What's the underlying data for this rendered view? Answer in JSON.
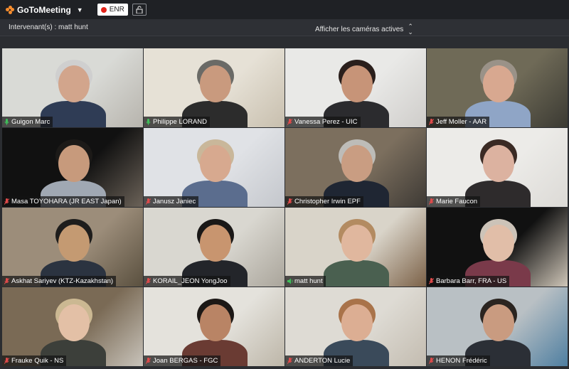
{
  "app": {
    "brand": "GoToMeeting",
    "record_label": "ENR",
    "speaker_label": "Intervenant(s) : matt hunt",
    "camera_filter": "Afficher les caméras actives"
  },
  "tiles": [
    {
      "name": "Guigon Marc",
      "mic": "on",
      "bg": "#d9dad6",
      "bg2": "#b7b4ad",
      "skin": "#d2a58c",
      "shirt": "#2f3c55",
      "hair": "#cfcfcf"
    },
    {
      "name": "Philippe LORAND",
      "mic": "on",
      "bg": "#e6e1d6",
      "bg2": "#c8bfae",
      "skin": "#c99a7e",
      "shirt": "#2c2c2c",
      "hair": "#6a6a66"
    },
    {
      "name": "Vanessa Perez - UIC",
      "mic": "muted",
      "bg": "#e9e9e7",
      "bg2": "#cfcdca",
      "skin": "#c79478",
      "shirt": "#2b2b2e",
      "hair": "#2a1f1c"
    },
    {
      "name": "Jeff Moller - AAR",
      "mic": "muted",
      "bg": "#6f6a57",
      "bg2": "#3b3a33",
      "skin": "#d8a890",
      "shirt": "#8fa5c6",
      "hair": "#9a9288"
    },
    {
      "name": "Masa TOYOHARA (JR EAST  Japan)",
      "mic": "muted",
      "bg": "#111111",
      "bg2": "#6b6258",
      "skin": "#c79a7c",
      "shirt": "#a0a8b3",
      "hair": "#1c1a18"
    },
    {
      "name": "Janusz Janiec",
      "mic": "muted",
      "bg": "#e0e2e6",
      "bg2": "#c4c7cc",
      "skin": "#d7a98f",
      "shirt": "#5b6d8e",
      "hair": "#c9b79a"
    },
    {
      "name": "Christopher Irwin  EPF",
      "mic": "muted",
      "bg": "#7c6f5e",
      "bg2": "#3e3a35",
      "skin": "#c99d82",
      "shirt": "#1f2633",
      "hair": "#bdbcb8"
    },
    {
      "name": "Marie Faucon",
      "mic": "muted",
      "bg": "#ecebe8",
      "bg2": "#dcdad6",
      "skin": "#dcb2a0",
      "shirt": "#2e2b2c",
      "hair": "#3a2a24"
    },
    {
      "name": "Askhat Sariyev (KTZ-Kazakhstan)",
      "mic": "muted",
      "bg": "#9c8d7a",
      "bg2": "#5a503f",
      "skin": "#c49a72",
      "shirt": "#2b3340",
      "hair": "#1e1d1c"
    },
    {
      "name": "KORAIL_JEON YongJoo",
      "mic": "muted",
      "bg": "#d9d7d0",
      "bg2": "#aaa59b",
      "skin": "#c8956f",
      "shirt": "#23252a",
      "hair": "#1a1817"
    },
    {
      "name": "matt hunt",
      "mic": "speaking",
      "bg": "#d9d4c9",
      "bg2": "#7c6248",
      "skin": "#e0b79e",
      "shirt": "#4a6050",
      "hair": "#b38b61"
    },
    {
      "name": "Barbara Barr, FRA - US",
      "mic": "muted",
      "bg": "#111111",
      "bg2": "#cfc6b8",
      "skin": "#e1bea8",
      "shirt": "#7a3a4a",
      "hair": "#ccc3b8"
    },
    {
      "name": "Frauke Quik - NS",
      "mic": "muted",
      "bg": "#7a6a55",
      "bg2": "#c8c3ba",
      "skin": "#e3c0a6",
      "shirt": "#3c3f3a",
      "hair": "#cbb892"
    },
    {
      "name": "Joan BERGAS - FGC",
      "mic": "muted",
      "bg": "#e4e2dc",
      "bg2": "#bdb6a8",
      "skin": "#b98465",
      "shirt": "#6a3b33",
      "hair": "#1c1816"
    },
    {
      "name": "ANDERTON Lucie",
      "mic": "muted",
      "bg": "#dedbd4",
      "bg2": "#c3bcb0",
      "skin": "#dcae93",
      "shirt": "#3a4a5a",
      "hair": "#a9734a"
    },
    {
      "name": "HENON Frédéric",
      "mic": "muted",
      "bg": "#b9c0c4",
      "bg2": "#4f7fa1",
      "skin": "#c99b80",
      "shirt": "#2b2f36",
      "hair": "#2a2420"
    }
  ]
}
